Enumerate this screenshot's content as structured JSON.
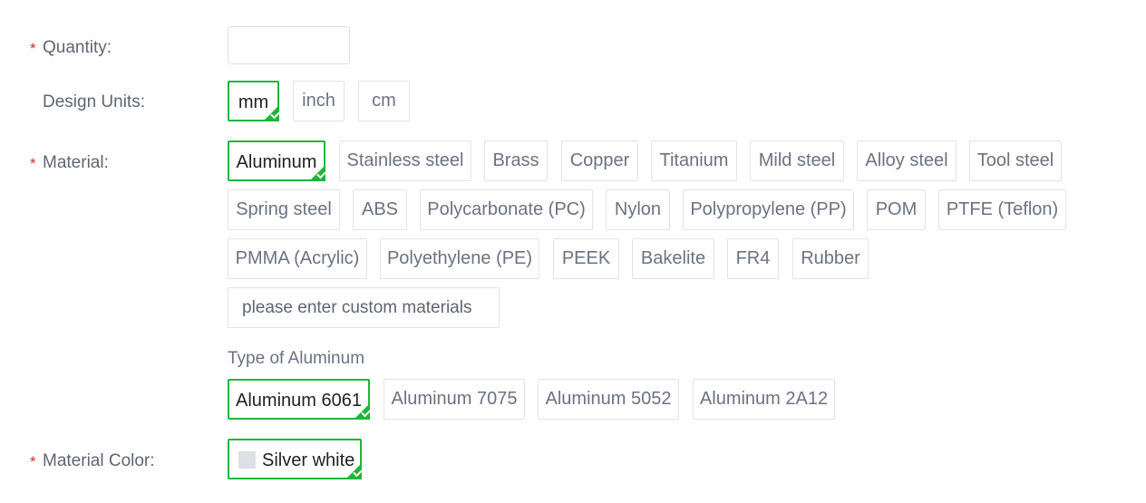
{
  "quantity": {
    "label": "Quantity:",
    "required_mark": "*",
    "value": ""
  },
  "design_units": {
    "label": "Design Units:",
    "options": [
      "mm",
      "inch",
      "cm"
    ],
    "selected": "mm"
  },
  "material": {
    "label": "Material:",
    "required_mark": "*",
    "options": [
      "Aluminum",
      "Stainless steel",
      "Brass",
      "Copper",
      "Titanium",
      "Mild steel",
      "Alloy steel",
      "Tool steel",
      "Spring steel",
      "ABS",
      "Polycarbonate (PC)",
      "Nylon",
      "Polypropylene (PP)",
      "POM",
      "PTFE (Teflon)",
      "PMMA (Acrylic)",
      "Polyethylene (PE)",
      "PEEK",
      "Bakelite",
      "FR4",
      "Rubber"
    ],
    "selected": "Aluminum",
    "custom_placeholder": "please enter custom materials"
  },
  "material_type": {
    "title": "Type of Aluminum",
    "options": [
      "Aluminum 6061",
      "Aluminum 7075",
      "Aluminum 5052",
      "Aluminum 2A12"
    ],
    "selected": "Aluminum 6061"
  },
  "material_color": {
    "label": "Material Color:",
    "required_mark": "*",
    "options": [
      "Silver white"
    ],
    "selected": "Silver white",
    "swatch_color": "#dde0e4"
  },
  "colors": {
    "accent": "#1db63b",
    "required": "#d2322d"
  }
}
